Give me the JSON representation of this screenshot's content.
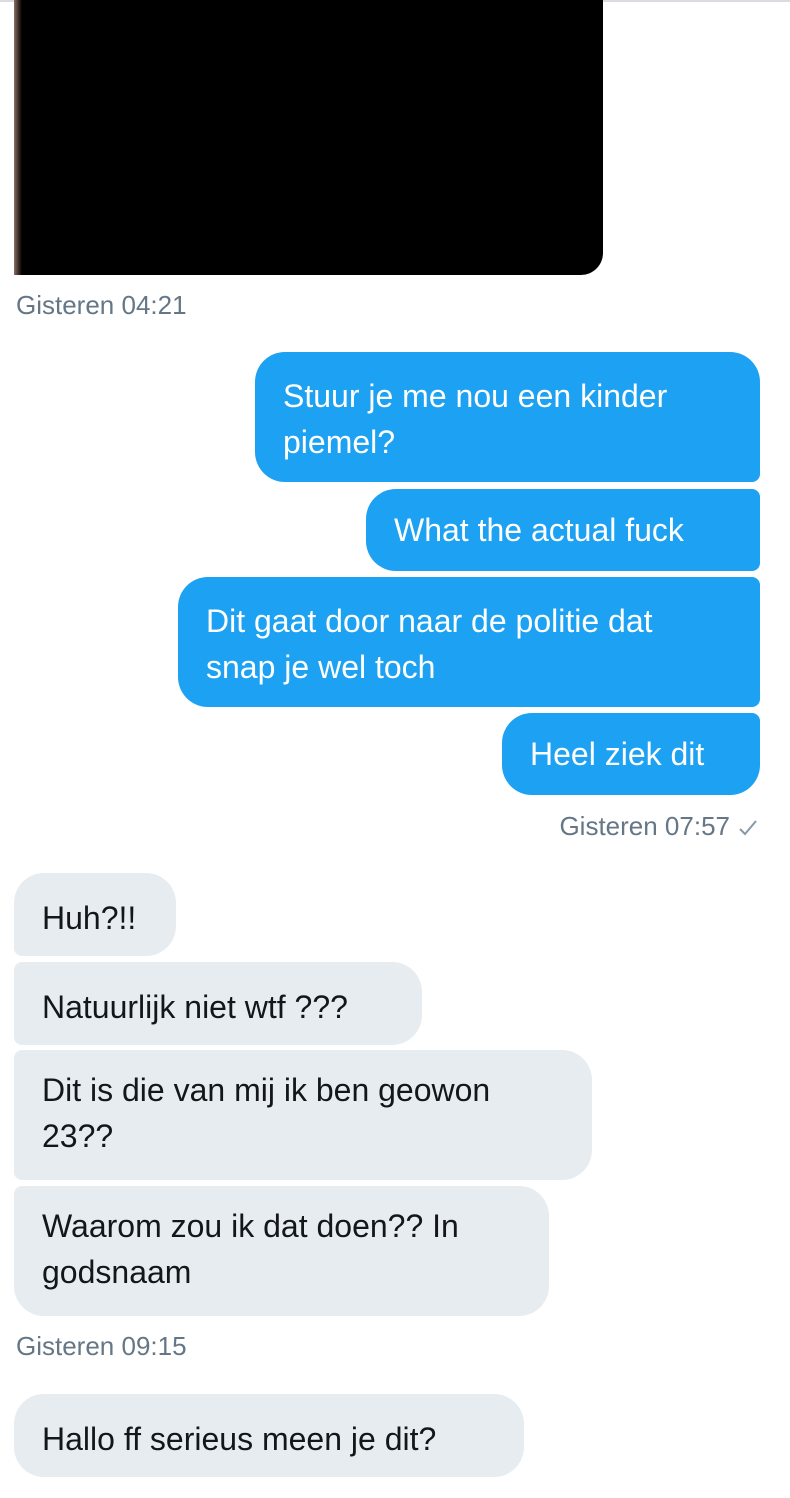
{
  "thread": {
    "media_timestamp": "Gisteren 04:21",
    "outgoing": [
      {
        "lines": [
          "Stuur je me nou een kinder",
          "piemel?"
        ]
      },
      {
        "lines": [
          "What the actual fuck"
        ]
      },
      {
        "lines": [
          "Dit gaat door naar de politie dat",
          "snap je wel toch"
        ]
      },
      {
        "lines": [
          "Heel ziek dit"
        ]
      }
    ],
    "outgoing_timestamp": "Gisteren 07:57",
    "outgoing_status_icon": "checkmark-icon",
    "incoming": [
      {
        "lines": [
          "Huh?!!"
        ]
      },
      {
        "lines": [
          "Natuurlijk niet wtf ???"
        ]
      },
      {
        "lines": [
          "Dit is die van mij ik ben geowon",
          "23??"
        ]
      },
      {
        "lines": [
          "Waarom zou ik dat doen?? In",
          "godsnaam"
        ]
      }
    ],
    "incoming_timestamp": "Gisteren 09:15",
    "incoming_last": {
      "lines": [
        "Hallo ff serieus meen je dit?"
      ]
    }
  },
  "colors": {
    "outgoing_bubble": "#1da1f2",
    "incoming_bubble": "#e6ecf0",
    "timestamp_text": "#657786"
  }
}
